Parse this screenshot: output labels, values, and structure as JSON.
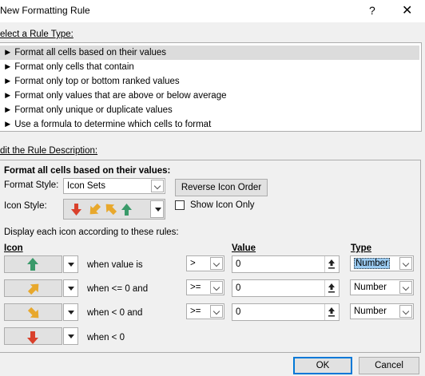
{
  "window": {
    "title": "New Formatting Rule",
    "help": "?",
    "close": "✕"
  },
  "rule_type": {
    "label": "elect a Rule Type:",
    "items": [
      {
        "label": "Format all cells based on their values",
        "selected": true
      },
      {
        "label": "Format only cells that contain",
        "selected": false
      },
      {
        "label": "Format only top or bottom ranked values",
        "selected": false
      },
      {
        "label": "Format only values that are above or below average",
        "selected": false
      },
      {
        "label": "Format only unique or duplicate values",
        "selected": false
      },
      {
        "label": "Use a formula to determine which cells to format",
        "selected": false
      }
    ]
  },
  "description": {
    "label": "dit the Rule Description:",
    "heading": "Format all cells based on their values:",
    "format_style_label": "Format Style:",
    "format_style_value": "Icon Sets",
    "reverse_button": "Reverse Icon Order",
    "icon_style_label": "Icon Style:",
    "show_icon_only": "Show Icon Only",
    "show_icon_only_checked": false,
    "display_rules_label": "Display each icon according to these rules:",
    "col_icon": "Icon",
    "col_value": "Value",
    "col_type": "Type",
    "rows": [
      {
        "icon": "green-up-arrow-icon",
        "condition": "when value is",
        "operator": ">",
        "value": "0",
        "type": "Number",
        "type_selected": true
      },
      {
        "icon": "yellow-up-right-arrow-icon",
        "condition": "when <= 0 and",
        "operator": ">=",
        "value": "0",
        "type": "Number",
        "type_selected": false
      },
      {
        "icon": "yellow-down-right-arrow-icon",
        "condition": "when < 0 and",
        "operator": ">=",
        "value": "0",
        "type": "Number",
        "type_selected": false
      },
      {
        "icon": "red-down-arrow-icon",
        "condition": "when < 0"
      }
    ]
  },
  "buttons": {
    "ok": "OK",
    "cancel": "Cancel"
  },
  "colors": {
    "green": "#3a9a6a",
    "yellow": "#e8a82c",
    "red": "#d9402b",
    "selection": "#99c9ef"
  }
}
